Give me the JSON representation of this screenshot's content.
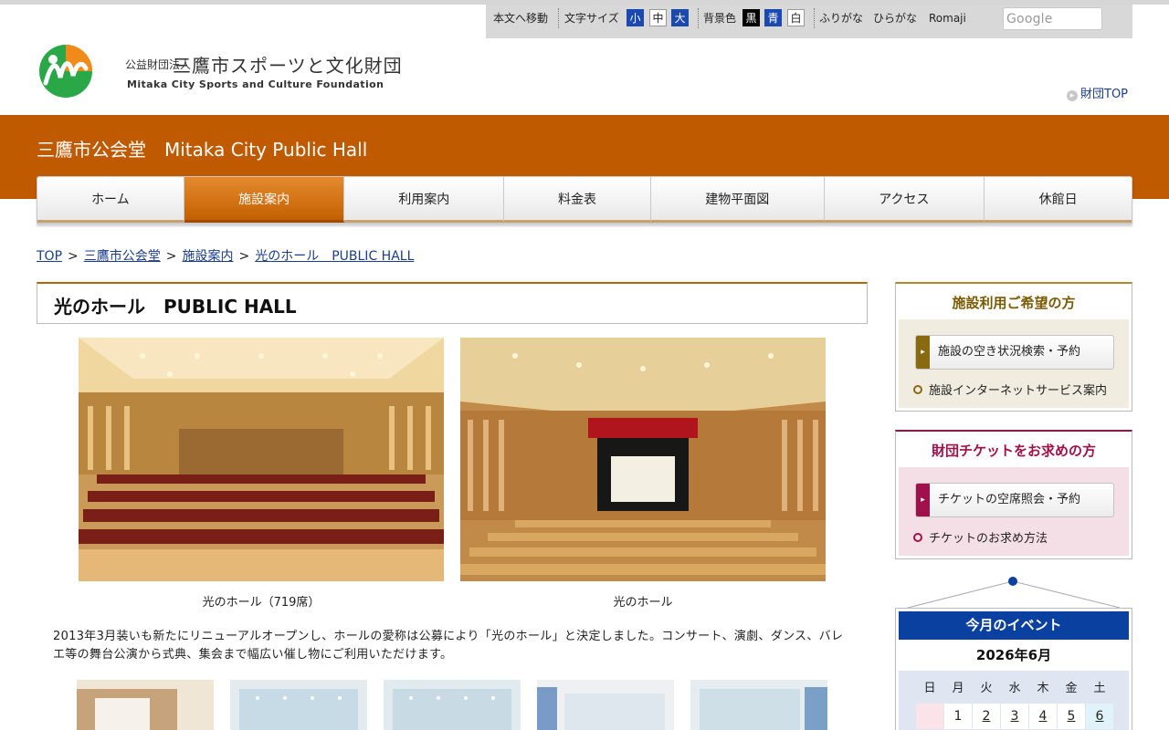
{
  "utility": {
    "skip": "本文へ移動",
    "font_size_label": "文字サイズ",
    "size_small": "小",
    "size_medium": "中",
    "size_large": "大",
    "bg_label": "背景色",
    "bg_black": "黒",
    "bg_blue": "青",
    "bg_white": "白",
    "furigana": "ふりがな",
    "hiragana": "ひらがな",
    "romaji": "Romaji",
    "search_placeholder": "Google"
  },
  "header": {
    "logo_small": "公益財団法人",
    "logo_main": "三鷹市スポーツと文化財団",
    "logo_en": "Mitaka City Sports and Culture Foundation",
    "foundation_top": "財団TOP"
  },
  "band": {
    "title": "三鷹市公会堂　Mitaka City Public Hall"
  },
  "nav": [
    {
      "label": "ホーム"
    },
    {
      "label": "施設案内"
    },
    {
      "label": "利用案内"
    },
    {
      "label": "料金表"
    },
    {
      "label": "建物平面図"
    },
    {
      "label": "アクセス"
    },
    {
      "label": "休館日"
    }
  ],
  "breadcrumb": {
    "items": [
      "TOP",
      "三鷹市公会堂",
      "施設案内",
      "光のホール　PUBLIC HALL"
    ],
    "separator": ">"
  },
  "main": {
    "title": "光のホール　PUBLIC HALL",
    "photo1_caption": "光のホール（719席）",
    "photo2_caption": "光のホール",
    "description": "2013年3月装いも新たにリニューアルオープンし、ホールの愛称は公募により「光のホール」と決定しました。コンサート、演劇、ダンス、バレエ等の舞台公演から式典、集会まで幅広い催し物にご利用いただけます。"
  },
  "sidebar": {
    "facility": {
      "heading": "施設利用ご希望の方",
      "button": "施設の空き状況検索・予約",
      "link": "施設インターネットサービス案内",
      "color": "#7a5a00"
    },
    "ticket": {
      "heading": "財団チケットをお求めの方",
      "button": "チケットの空席照会・予約",
      "link": "チケットのお求め方法",
      "color": "#a0104a"
    },
    "calendar": {
      "heading": "今月のイベント",
      "month": "2026年6月",
      "dow": [
        "日",
        "月",
        "火",
        "水",
        "木",
        "金",
        "土"
      ],
      "days": [
        "",
        "1",
        "2",
        "3",
        "4",
        "5",
        "6"
      ]
    }
  },
  "colors": {
    "band": "#c05a00",
    "nav_active": "#d07020",
    "link": "#1a3d8f",
    "calendar_header": "#0a41a0"
  }
}
